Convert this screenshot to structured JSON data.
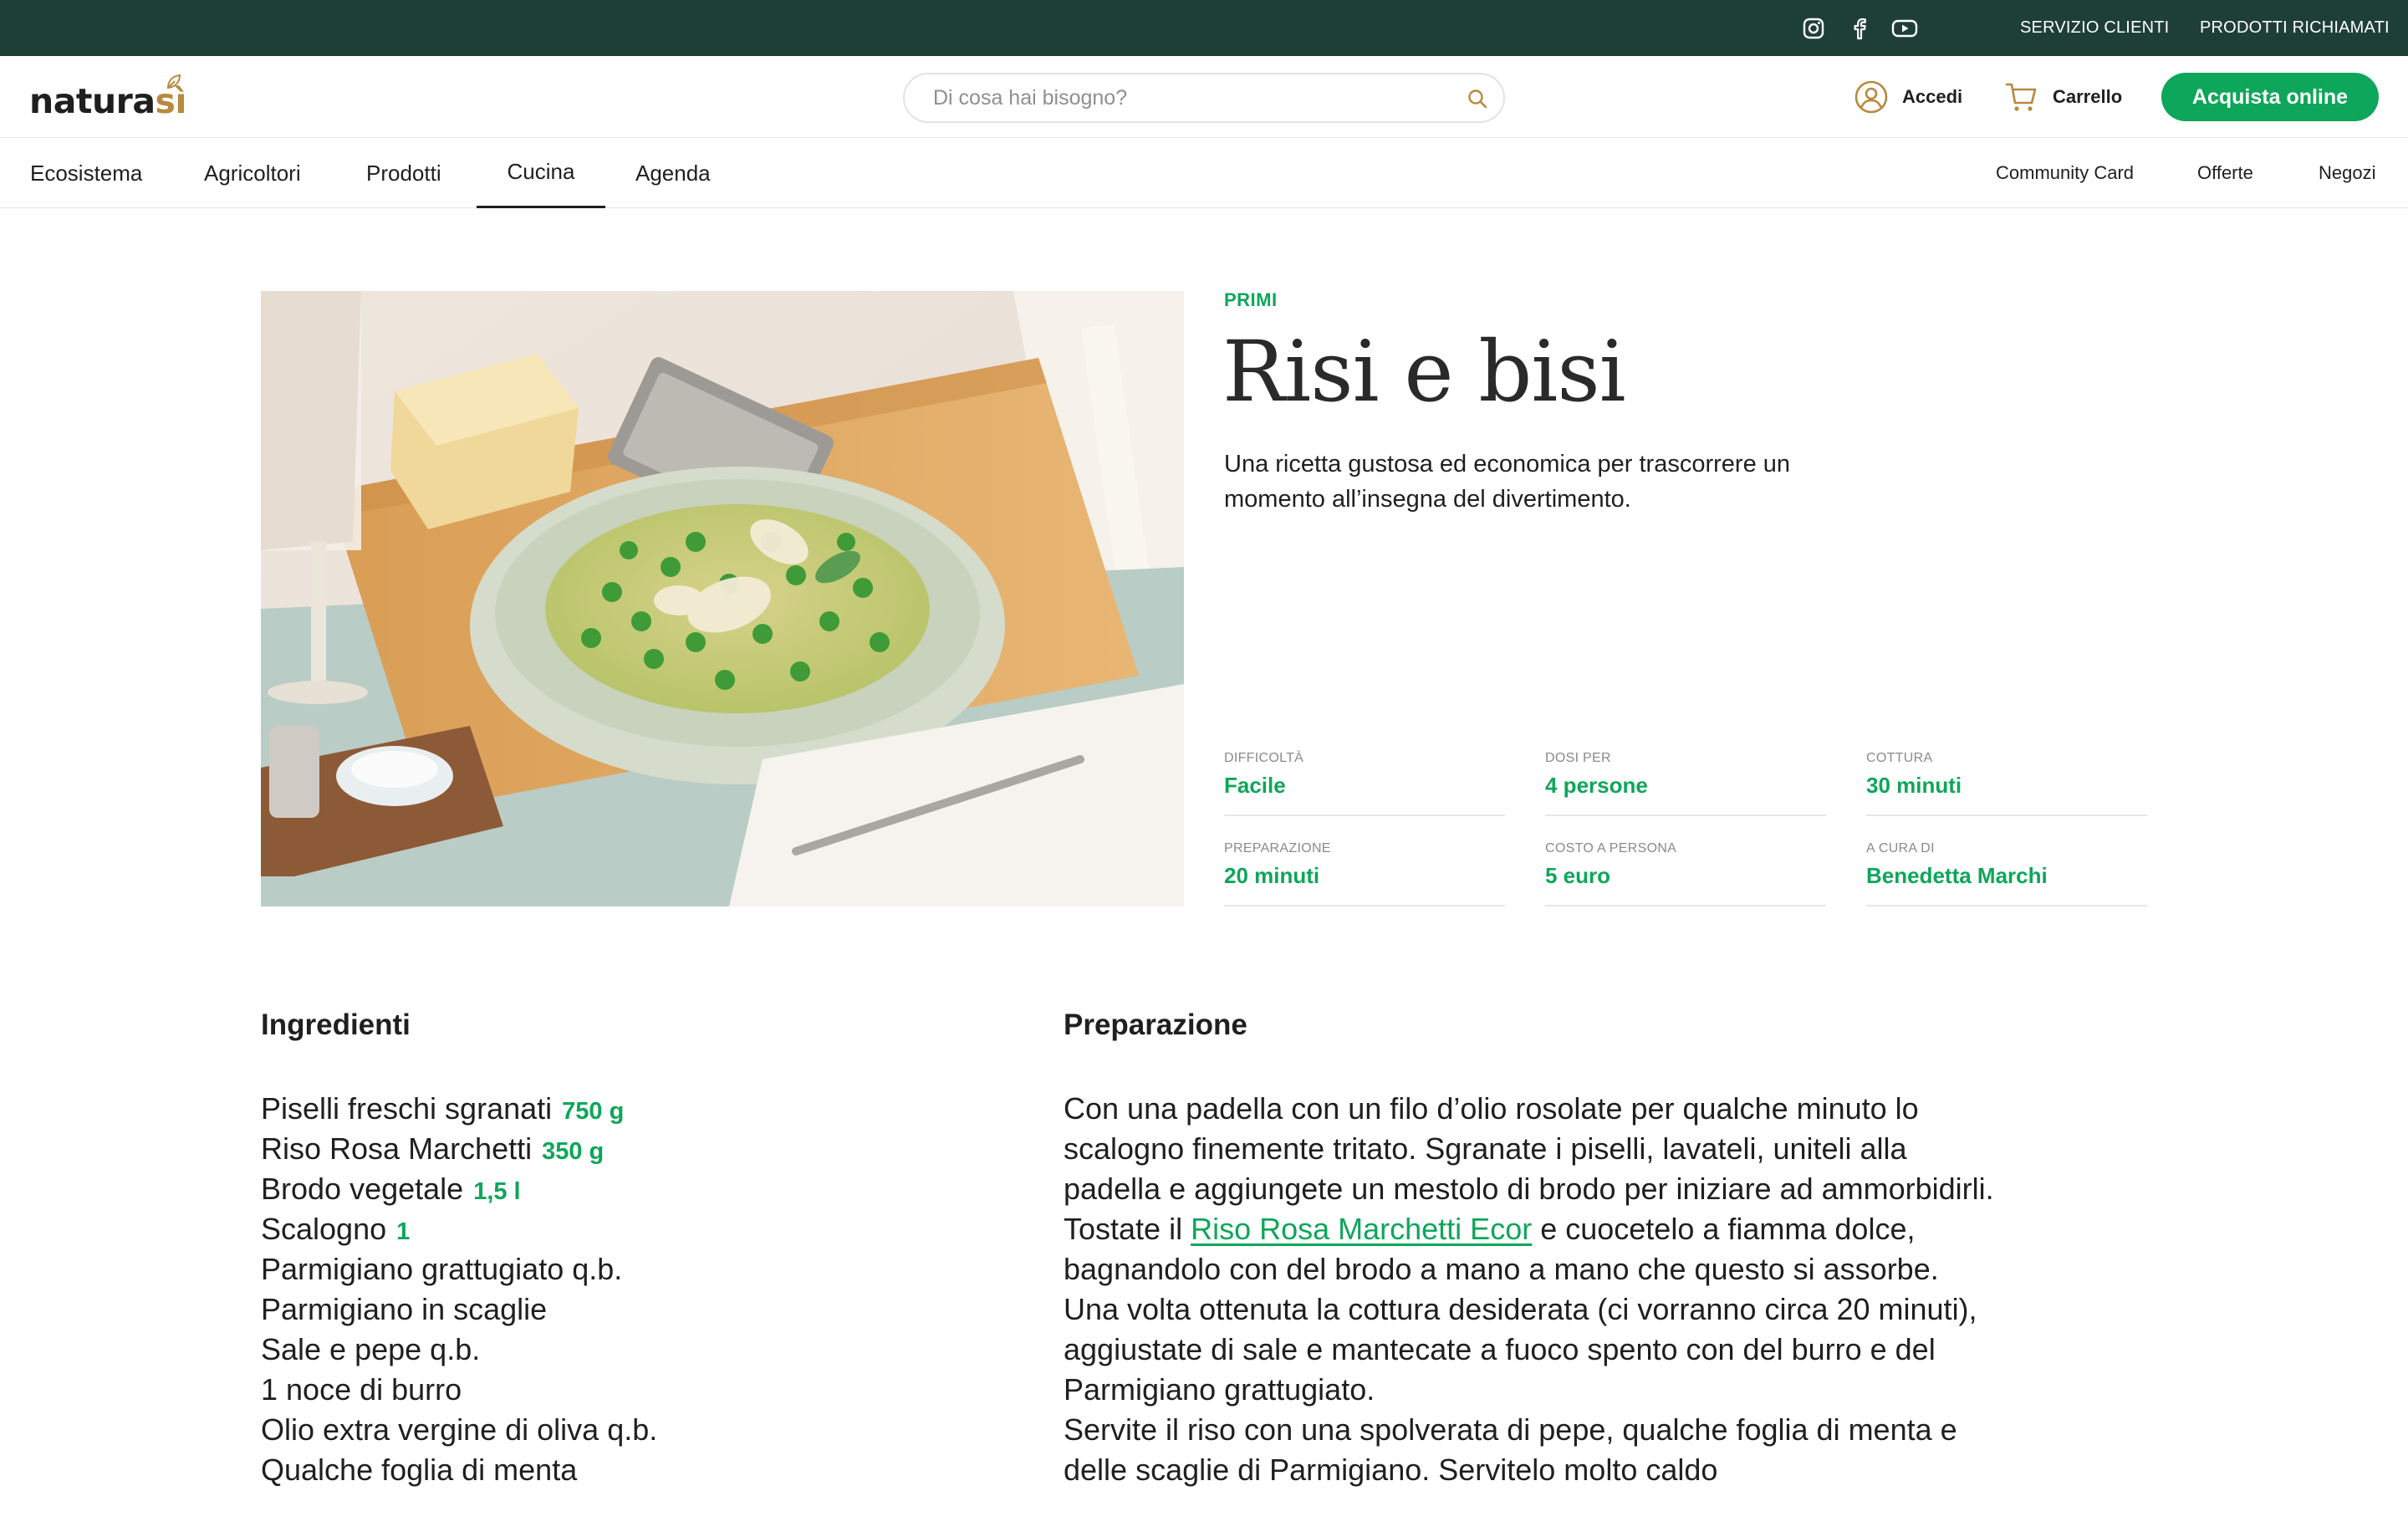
{
  "topbar": {
    "social": [
      "instagram-icon",
      "facebook-icon",
      "youtube-icon"
    ],
    "links": [
      "SERVIZIO CLIENTI",
      "PRODOTTI RICHIAMATI"
    ]
  },
  "header": {
    "logo_word": "natura",
    "logo_accent": "sì",
    "search_placeholder": "Di cosa hai bisogno?",
    "login_label": "Accedi",
    "cart_label": "Carrello",
    "cta_label": "Acquista online"
  },
  "nav": {
    "items": [
      "Ecosistema",
      "Agricoltori",
      "Prodotti",
      "Cucina",
      "Agenda"
    ],
    "active": "Cucina",
    "right_items": [
      "Community Card",
      "Offerte",
      "Negozi"
    ]
  },
  "recipe": {
    "category": "PRIMI",
    "title": "Risi e bisi",
    "subtitle": "Una ricetta gustosa ed economica per trascorrere un momento all’insegna del divertimento.",
    "meta": [
      {
        "label": "DIFFICOLTÀ",
        "value": "Facile"
      },
      {
        "label": "DOSI PER",
        "value": "4 persone"
      },
      {
        "label": "COTTURA",
        "value": "30 minuti"
      },
      {
        "label": "PREPARAZIONE",
        "value": "20 minuti"
      },
      {
        "label": "COSTO A PERSONA",
        "value": "5 euro"
      },
      {
        "label": "A CURA DI",
        "value": "Benedetta Marchi"
      }
    ]
  },
  "ingredients": {
    "title": "Ingredienti",
    "items": [
      {
        "name": "Piselli freschi sgranati",
        "qty": "750 g"
      },
      {
        "name": "Riso Rosa Marchetti",
        "qty": "350 g"
      },
      {
        "name": "Brodo vegetale",
        "qty": "1,5 l"
      },
      {
        "name": "Scalogno",
        "qty": "1"
      },
      {
        "name": "Parmigiano grattugiato q.b.",
        "qty": ""
      },
      {
        "name": "Parmigiano in scaglie",
        "qty": ""
      },
      {
        "name": "Sale e pepe q.b.",
        "qty": ""
      },
      {
        "name": "1 noce di burro",
        "qty": ""
      },
      {
        "name": "Olio extra vergine di oliva q.b.",
        "qty": ""
      },
      {
        "name": "Qualche foglia di menta",
        "qty": ""
      }
    ]
  },
  "preparation": {
    "title": "Preparazione",
    "text_before_link": "Con una padella con un filo d’olio rosolate per qualche minuto lo scalogno finemente tritato. Sgranate i piselli, lavateli, uniteli alla padella e aggiungete un mestolo di brodo per iniziare ad ammorbidirli. Tostate il ",
    "link_text": "Riso Rosa Marchetti Ecor",
    "text_after_link": " e cuocetelo a fiamma dolce, bagnandolo con del brodo a mano a mano che questo si assorbe.",
    "paragraph_2": "Una volta ottenuta la cottura desiderata (ci vorranno circa 20 minuti), aggiustate di sale e mantecate a fuoco spento con del burro e del Parmigiano grattugiato.",
    "paragraph_3": "Servite il riso con una spolverata di pepe, qualche foglia di menta e delle scaglie di Parmigiano. Servitelo molto caldo"
  },
  "colors": {
    "topbar": "#1e3f36",
    "accent_green": "#0ea65a",
    "logo_gold": "#b8893f"
  }
}
